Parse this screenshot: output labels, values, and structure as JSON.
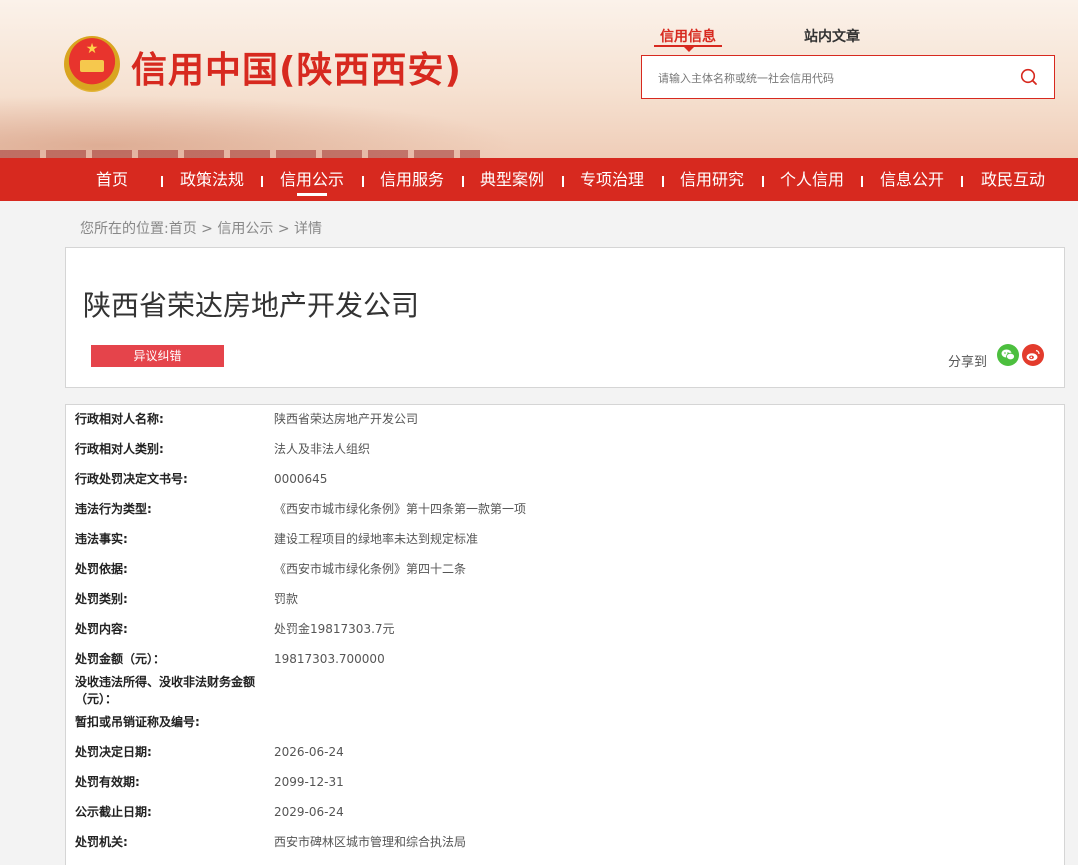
{
  "header": {
    "site_title": "信用中国(陕西西安)",
    "emblem": "national-emblem-icon",
    "search_tabs": [
      "信用信息",
      "站内文章"
    ],
    "search_placeholder": "请输入主体名称或统一社会信用代码",
    "search_icon": "search-icon"
  },
  "nav": {
    "items": [
      "首页",
      "政策法规",
      "信用公示",
      "信用服务",
      "典型案例",
      "专项治理",
      "信用研究",
      "个人信用",
      "信息公开",
      "政民互动"
    ],
    "active_index": 2
  },
  "breadcrumb": {
    "prefix": "您所在的位置:",
    "items": [
      "首页",
      "信用公示",
      "详情"
    ],
    "separator": ">"
  },
  "title_card": {
    "company_name": "陕西省荣达房地产开发公司",
    "dispute_label": "异议纠错",
    "share_label": "分享到",
    "share_icons": [
      "wechat-icon",
      "weibo-icon"
    ]
  },
  "details": [
    {
      "label": "行政相对人名称:",
      "value": "陕西省荣达房地产开发公司"
    },
    {
      "label": "行政相对人类别:",
      "value": "法人及非法人组织"
    },
    {
      "label": "行政处罚决定文书号:",
      "value": "0000645"
    },
    {
      "label": "违法行为类型:",
      "value": "《西安市城市绿化条例》第十四条第一款第一项"
    },
    {
      "label": "违法事实:",
      "value": "建设工程项目的绿地率未达到规定标准"
    },
    {
      "label": "处罚依据:",
      "value": "《西安市城市绿化条例》第四十二条"
    },
    {
      "label": "处罚类别:",
      "value": "罚款"
    },
    {
      "label": "处罚内容:",
      "value": "处罚金19817303.7元"
    },
    {
      "label": "处罚金额（元）：",
      "value": "19817303.700000"
    },
    {
      "label": "没收违法所得、没收非法财务金额（元）：",
      "value": ""
    },
    {
      "label": "暂扣或吊销证称及编号:",
      "value": ""
    },
    {
      "label": "处罚决定日期:",
      "value": "2026-06-24"
    },
    {
      "label": "处罚有效期:",
      "value": "2099-12-31"
    },
    {
      "label": "公示截止日期:",
      "value": "2029-06-24"
    },
    {
      "label": "处罚机关:",
      "value": "西安市碑林区城市管理和综合执法局"
    }
  ],
  "colors": {
    "brand_red": "#d7291f",
    "dispute_red": "#e5444b",
    "wechat_green": "#4cbf3e",
    "weibo_red": "#e33b2c"
  }
}
